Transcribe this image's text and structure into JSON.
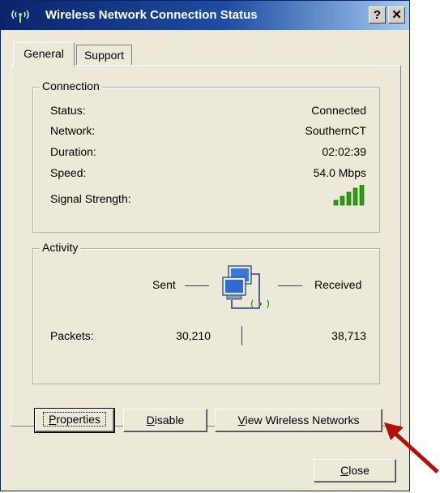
{
  "window": {
    "title": "Wireless Network Connection Status",
    "help_label": "?",
    "close_label": "✕"
  },
  "tabs": [
    {
      "label": "General",
      "selected": true
    },
    {
      "label": "Support",
      "selected": false
    }
  ],
  "connection": {
    "group_label": "Connection",
    "rows": [
      {
        "label": "Status:",
        "value": "Connected"
      },
      {
        "label": "Network:",
        "value": "SouthernCT"
      },
      {
        "label": "Duration:",
        "value": "02:02:39"
      },
      {
        "label": "Speed:",
        "value": "54.0 Mbps"
      }
    ],
    "signal_label": "Signal Strength:",
    "signal_bars": 5,
    "signal_max": 5
  },
  "activity": {
    "group_label": "Activity",
    "sent_label": "Sent",
    "received_label": "Received",
    "packets_label": "Packets:",
    "packets_sent": "30,210",
    "packets_received": "38,713"
  },
  "buttons": {
    "properties": {
      "label_ul": "P",
      "label_rest": "roperties"
    },
    "disable": {
      "label_ul": "D",
      "label_rest": "isable"
    },
    "view": {
      "label_ul": "V",
      "label_rest": "iew Wireless Networks"
    },
    "close": {
      "label_ul": "C",
      "label_rest": "lose"
    }
  },
  "colors": {
    "signal": "#2e9b1a",
    "titlebar": "#0a246a",
    "arrow": "#b01010"
  }
}
